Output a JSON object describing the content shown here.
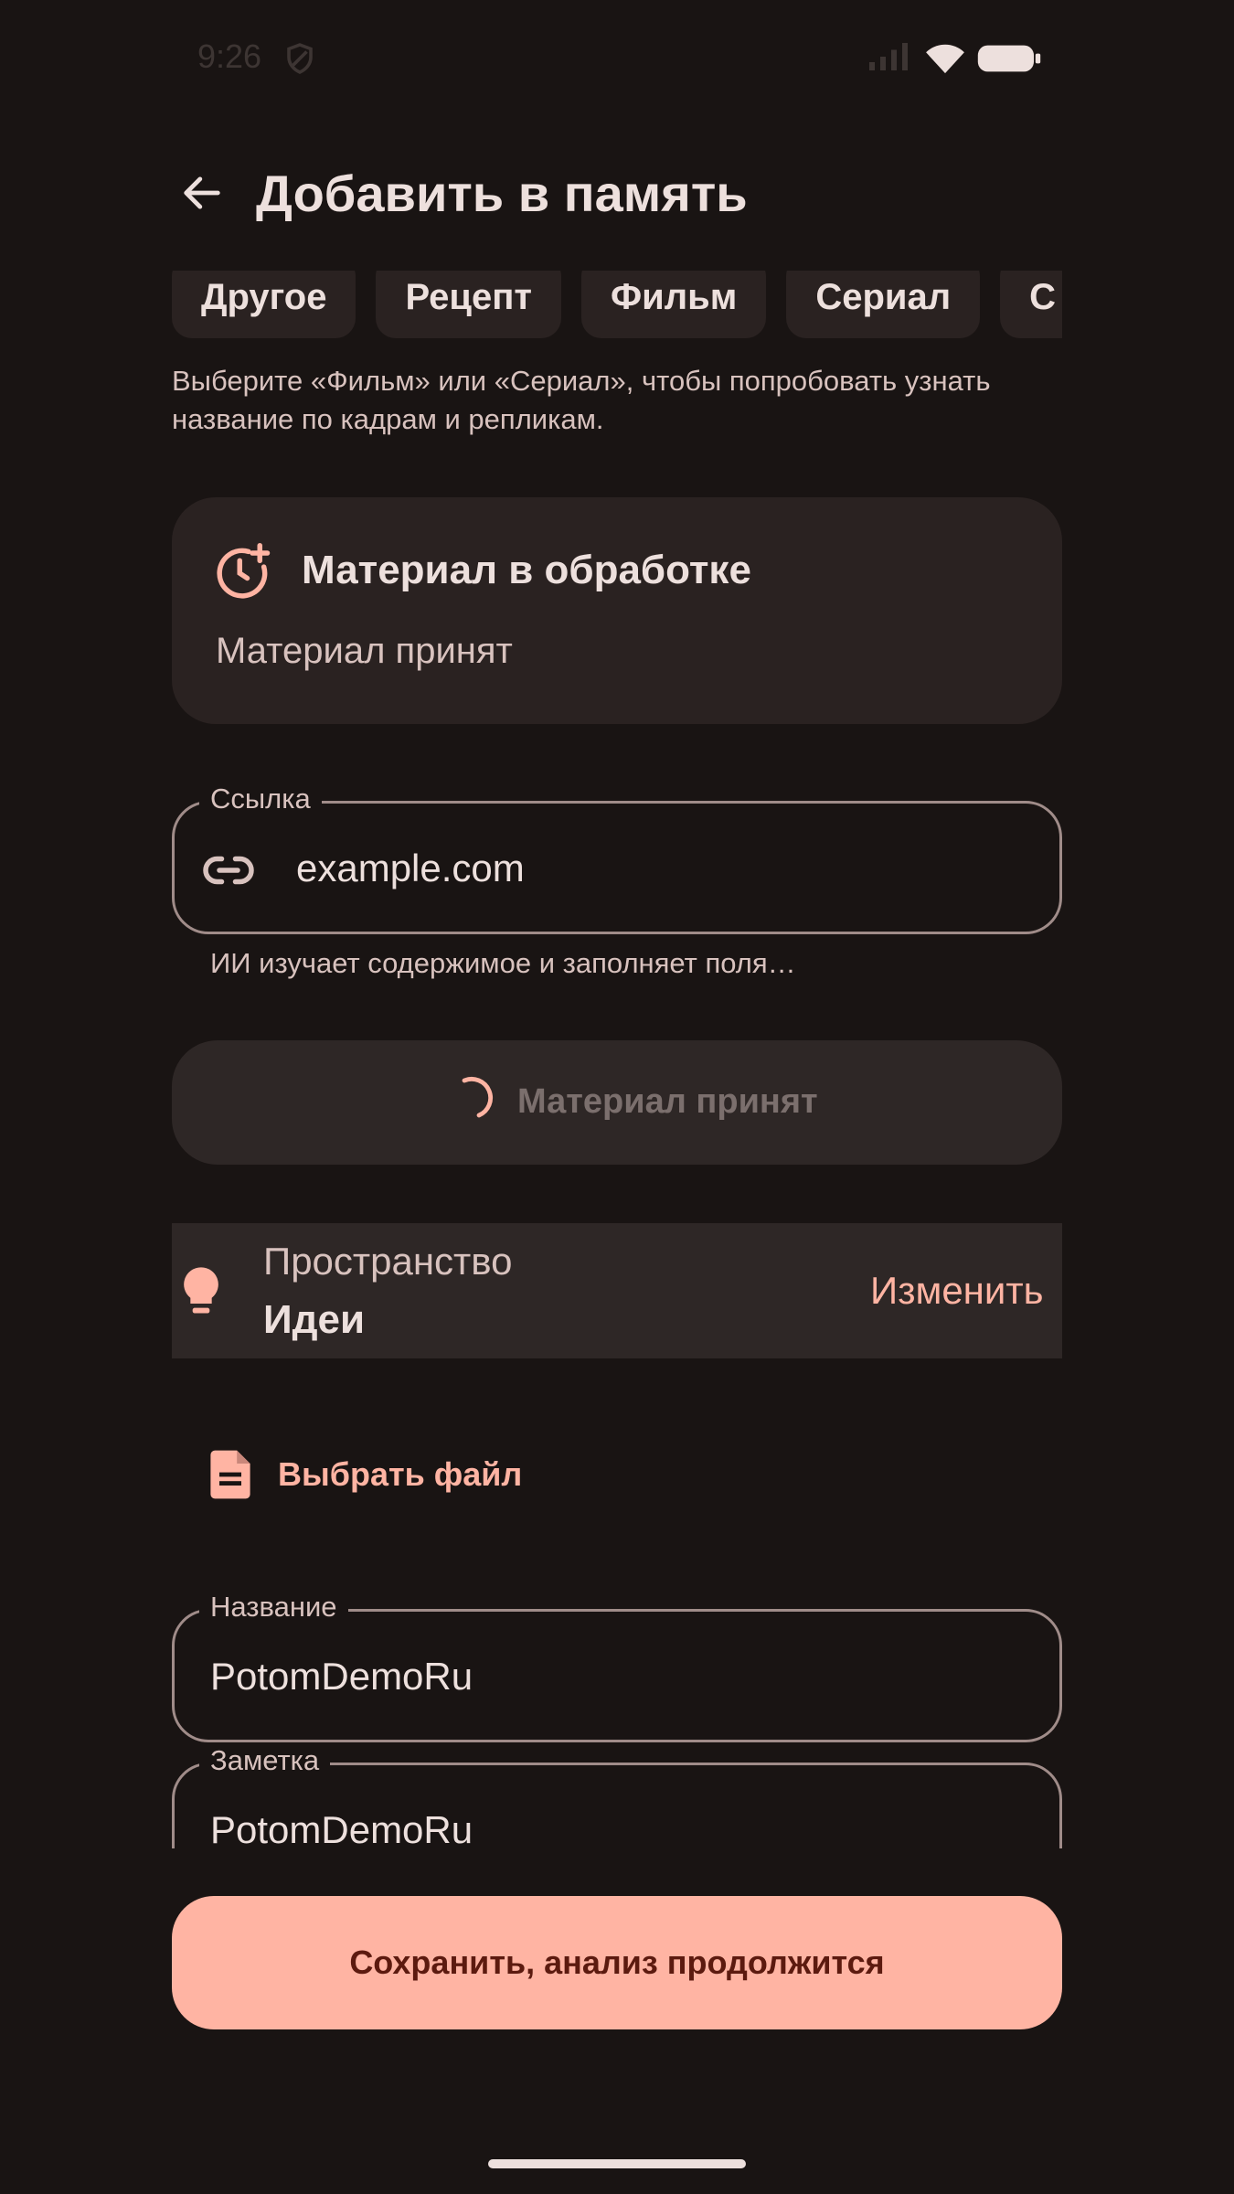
{
  "status_bar": {
    "time": "9:26"
  },
  "header": {
    "title": "Добавить в память"
  },
  "categories": [
    "Другое",
    "Рецепт",
    "Фильм",
    "Сериал",
    "С"
  ],
  "hint": "Выберите «Фильм» или «Сериал», чтобы попробовать узнать название по кадрам и репликам.",
  "processing_card": {
    "title": "Материал в обработке",
    "subtitle": "Материал принят"
  },
  "link_field": {
    "label": "Ссылка",
    "value": "example.com",
    "support_text": "ИИ изучает содержимое и заполняет поля…"
  },
  "status_button": {
    "label": "Материал принят"
  },
  "space": {
    "label": "Пространство",
    "value": "Идеи",
    "change_label": "Изменить"
  },
  "file_button": {
    "label": "Выбрать файл"
  },
  "name_field": {
    "label": "Название",
    "value": "PotomDemoRu"
  },
  "note_field": {
    "label": "Заметка",
    "value": "PotomDemoRu"
  },
  "save_button": {
    "label": "Сохранить, анализ продолжится"
  },
  "colors": {
    "background": "#191413",
    "surface": "#2a2221",
    "accent": "#FFB4A3",
    "on_accent": "#5c1a0f",
    "outline": "#A08C89"
  }
}
